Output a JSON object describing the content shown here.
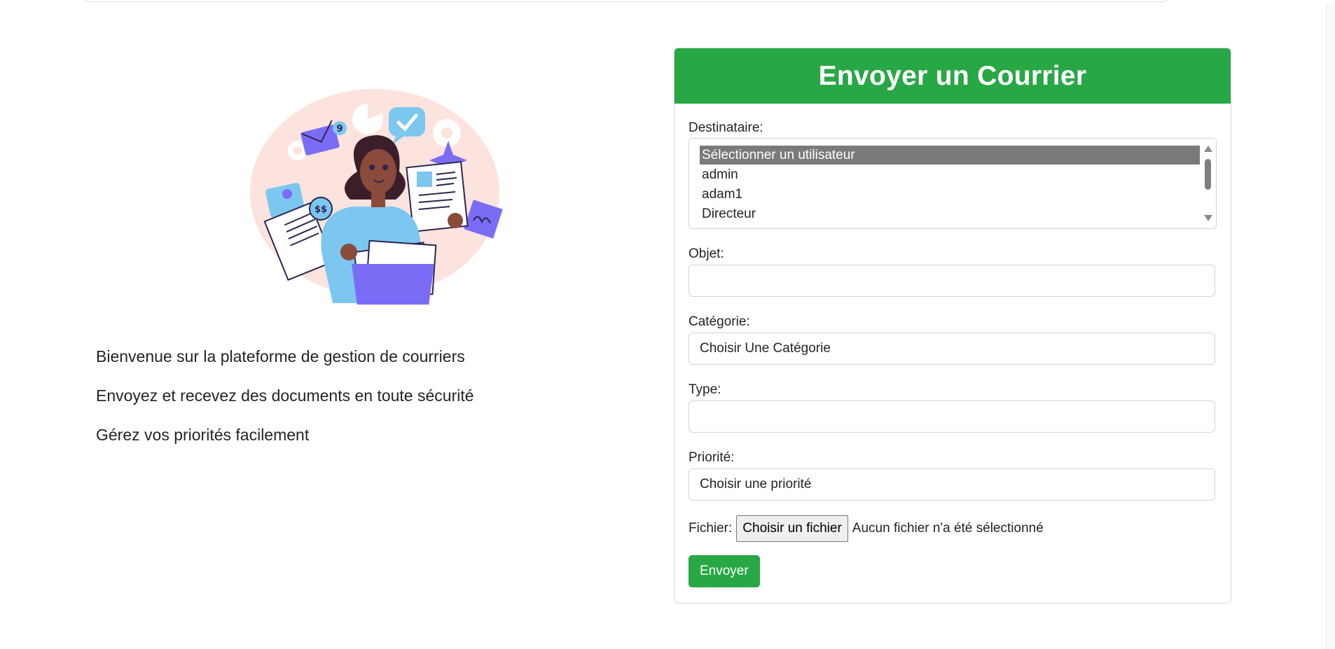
{
  "intro": {
    "line1": "Bienvenue sur la plateforme de gestion de courriers",
    "line2": "Envoyez et recevez des documents en toute sécurité",
    "line3": "Gérez vos priorités facilement"
  },
  "illustration": {
    "badge_count": "9",
    "money_label": "$$"
  },
  "form": {
    "title": "Envoyer un Courrier",
    "recipient_label": "Destinataire:",
    "recipient_options": [
      "Sélectionner un utilisateur",
      "admin",
      "adam1",
      "Directeur"
    ],
    "recipient_selected": "Sélectionner un utilisateur",
    "subject_label": "Objet:",
    "subject_value": "",
    "category_label": "Catégorie:",
    "category_value": "Choisir Une Catégorie",
    "type_label": "Type:",
    "type_value": "",
    "priority_label": "Priorité:",
    "priority_value": "Choisir une priorité",
    "file_label": "Fichier:",
    "file_button": "Choisir un fichier",
    "file_status": "Aucun fichier n'a été sélectionné",
    "submit_label": "Envoyer"
  },
  "colors": {
    "accent": "#28a745",
    "selected_option": "#7a7a7a",
    "illustration_purple": "#7b6cf6",
    "illustration_blue": "#7cc7f0",
    "illustration_blush": "#fde3dd"
  }
}
